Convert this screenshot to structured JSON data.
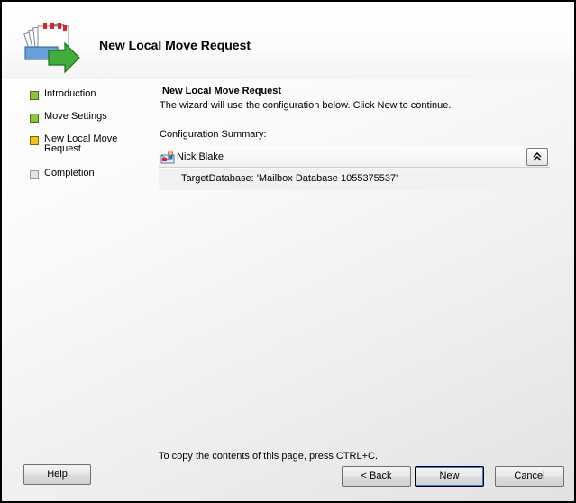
{
  "header": {
    "title": "New Local Move Request",
    "icon": "move-mailbox-icon"
  },
  "steps": [
    {
      "label": "Introduction",
      "state": "done"
    },
    {
      "label": "Move Settings",
      "state": "done"
    },
    {
      "label": "New Local Move Request",
      "state": "current"
    },
    {
      "label": "Completion",
      "state": "pending"
    }
  ],
  "main": {
    "title": "New Local Move Request",
    "description": "The wizard will use the configuration below.  Click New to continue.",
    "summary_label": "Configuration Summary:",
    "summary": {
      "name": "Nick Blake",
      "detail": "TargetDatabase: 'Mailbox Database 1055375537'"
    }
  },
  "footer": {
    "note": "To copy the contents of this page, press CTRL+C."
  },
  "buttons": {
    "help": "Help",
    "back": "< Back",
    "new": "New",
    "cancel": "Cancel"
  },
  "colors": {
    "step_done": "#8cc63e",
    "step_current": "#f2c41b",
    "step_pending": "#e4e4e4"
  }
}
